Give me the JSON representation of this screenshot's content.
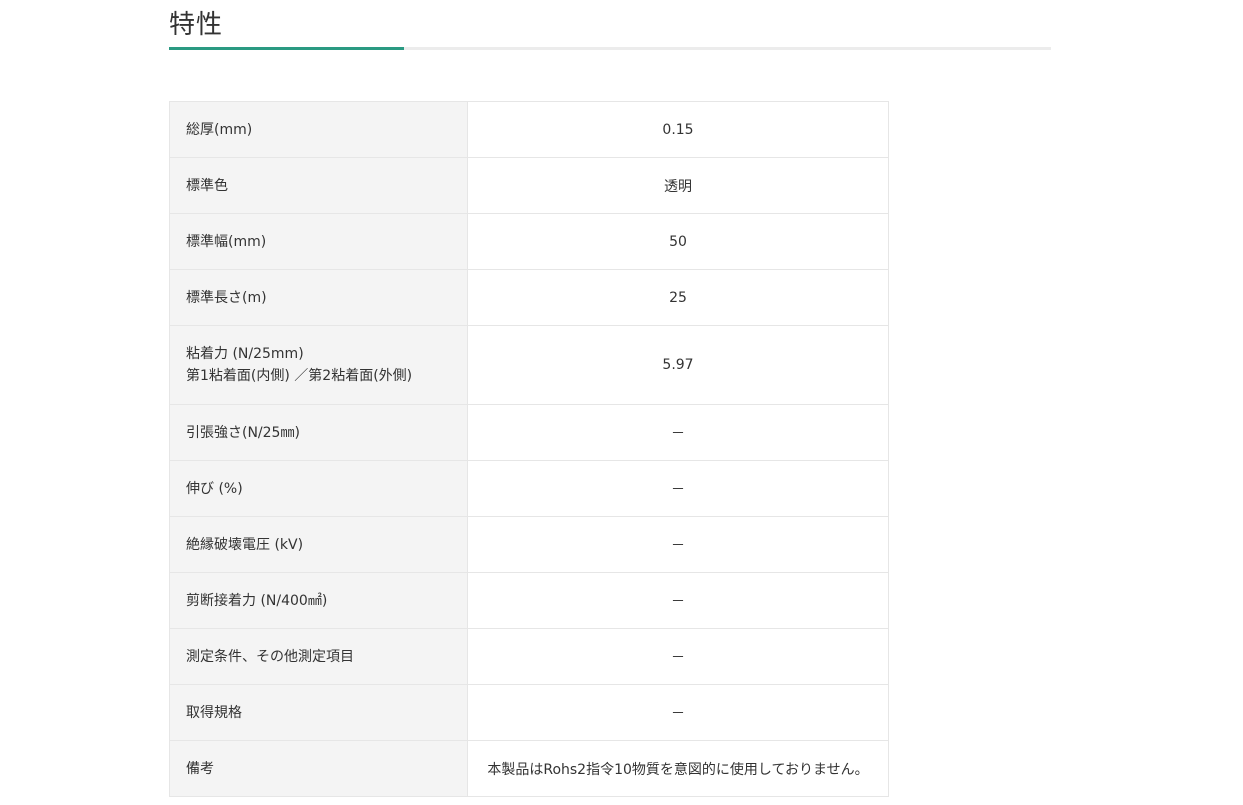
{
  "section": {
    "title": "特性"
  },
  "accent_color": "#2a9a82",
  "specs": [
    {
      "label": "総厚(mm)",
      "value": "0.15"
    },
    {
      "label": "標準色",
      "value": "透明"
    },
    {
      "label": "標準幅(mm)",
      "value": "50"
    },
    {
      "label": "標準長さ(m)",
      "value": "25"
    },
    {
      "label_lines": [
        "粘着力 (N/25mm)",
        "第1粘着面(内側) ／第2粘着面(外側)"
      ],
      "value": "5.97"
    },
    {
      "label": "引張強さ(N/25㎜)",
      "value": "－"
    },
    {
      "label": "伸び (%)",
      "value": "－"
    },
    {
      "label": "絶縁破壊電圧 (kV)",
      "value": "－"
    },
    {
      "label": "剪断接着力 (N/400㎟)",
      "value": "－"
    },
    {
      "label": "測定条件、その他測定項目",
      "value": "－"
    },
    {
      "label": "取得規格",
      "value": "－"
    },
    {
      "label": "備考",
      "value": "本製品はRohs2指令10物質を意図的に使用しておりません。"
    }
  ]
}
